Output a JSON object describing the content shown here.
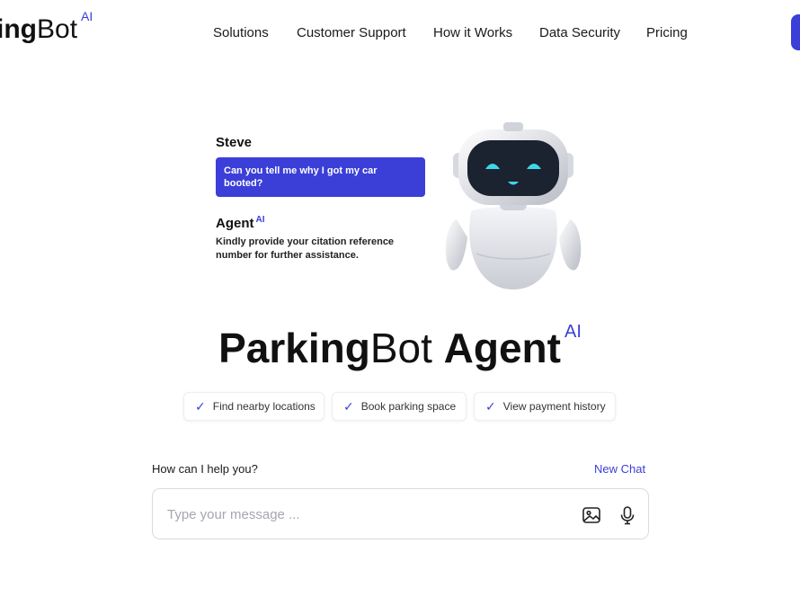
{
  "header": {
    "logo": {
      "bold": "ing",
      "light": "Bot",
      "sup": "AI"
    },
    "nav": [
      {
        "label": "Solutions"
      },
      {
        "label": "Customer Support"
      },
      {
        "label": "How it Works"
      },
      {
        "label": "Data Security"
      },
      {
        "label": "Pricing"
      }
    ]
  },
  "chat_preview": {
    "user_name": "Steve",
    "user_message": "Can you tell me why I got my car booted?",
    "agent_name": "Agent",
    "agent_badge": "AI",
    "agent_message": "Kindly provide your citation reference number for further assistance."
  },
  "hero": {
    "title_bold": "Parking",
    "title_light": "Bot",
    "title_bold2": "Agent",
    "title_sup": "AI"
  },
  "features": [
    {
      "label": "Find nearby locations",
      "icon": "check-icon"
    },
    {
      "label": "Book parking space",
      "icon": "check-icon"
    },
    {
      "label": "View payment history",
      "icon": "check-icon"
    }
  ],
  "composer": {
    "prompt": "How can I help you?",
    "new_chat": "New Chat",
    "placeholder": "Type your message ...",
    "icons": [
      "image-icon",
      "microphone-icon"
    ]
  },
  "colors": {
    "accent": "#3b3fd8",
    "text": "#111111",
    "border": "#d8dbe1"
  }
}
